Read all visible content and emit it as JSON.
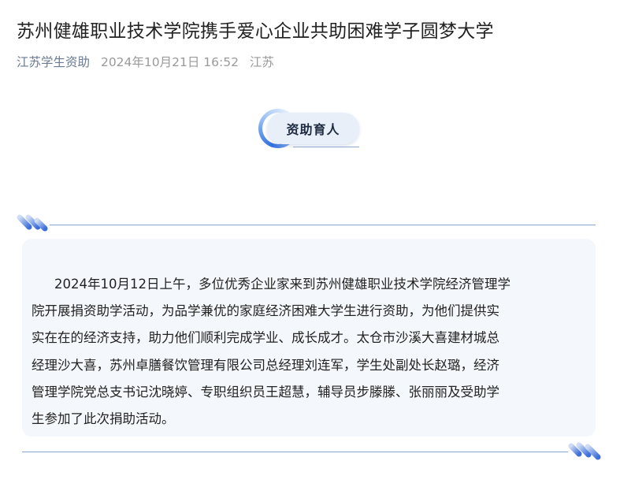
{
  "article": {
    "title": "苏州健雄职业技术学院携手爱心企业共助困难学子圆梦大学",
    "account": "江苏学生资助",
    "datetime": "2024年10月21日 16:52",
    "location": "江苏"
  },
  "section": {
    "heading": "资助育人"
  },
  "body": {
    "lines": [
      "2024年10月12日上午，多位优秀企业家来到苏州健雄职业技术学院经济管理学",
      "院开展捐资助学活动，为品学兼优的家庭经济困难大学生进行资助，为他们提供实",
      "实在在的经济支持，助力他们顺利完成学业、成长成才。太仓市沙溪大喜建材城总",
      "经理沙大喜，苏州卓膳餐饮管理有限公司总经理刘连军，学生处副处长赵璐，经济",
      "管理学院党总支书记沈晓婷、专职组织员王超慧，辅导员步滕滕、张丽丽及受助学",
      "生参加了此次捐助活动。"
    ]
  },
  "colors": {
    "accent_blue": "#2f6fe0",
    "rule": "#8fa7cc",
    "panel": "#f4f7fb",
    "meta_gray": "#9a9a9a",
    "account_link": "#6a7a92"
  }
}
